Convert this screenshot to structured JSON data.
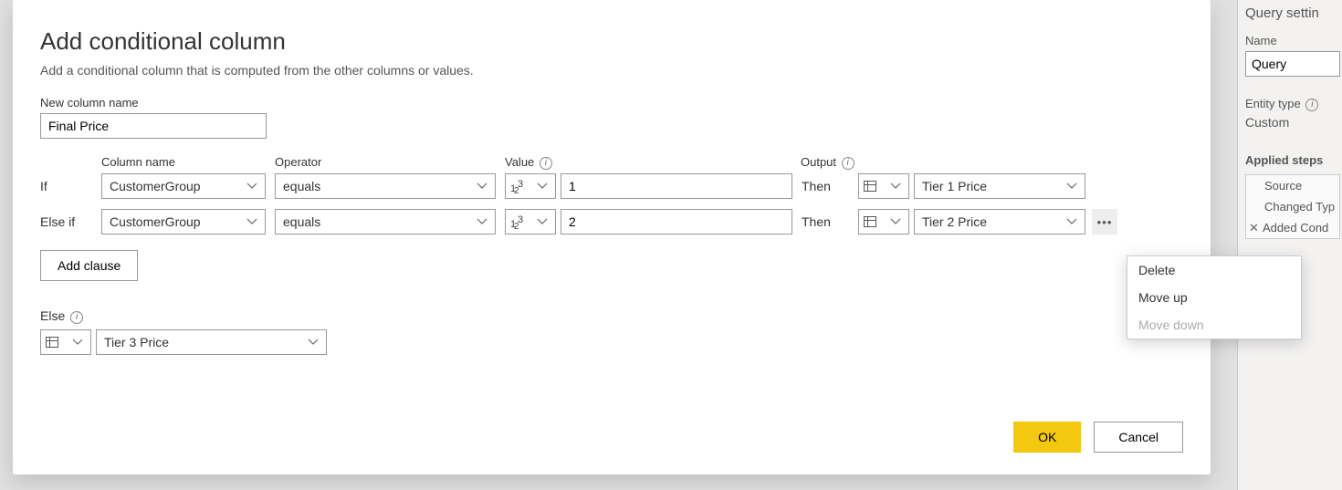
{
  "dialog": {
    "title": "Add conditional column",
    "description": "Add a conditional column that is computed from the other columns or values.",
    "new_col_label": "New column name",
    "new_col_value": "Final Price",
    "headers": {
      "column": "Column name",
      "operator": "Operator",
      "value": "Value",
      "output": "Output"
    },
    "clauses": [
      {
        "prefix": "If",
        "column": "CustomerGroup",
        "operator": "equals",
        "value_type": "number",
        "value": "1",
        "then": "Then",
        "output_type": "column",
        "output": "Tier 1 Price",
        "has_menu": false
      },
      {
        "prefix": "Else if",
        "column": "CustomerGroup",
        "operator": "equals",
        "value_type": "number",
        "value": "2",
        "then": "Then",
        "output_type": "column",
        "output": "Tier 2 Price",
        "has_menu": true
      }
    ],
    "add_clause_label": "Add clause",
    "else_label": "Else",
    "else_output_type": "column",
    "else_output": "Tier 3 Price",
    "ok_label": "OK",
    "cancel_label": "Cancel"
  },
  "context_menu": {
    "delete": "Delete",
    "move_up": "Move up",
    "move_down": "Move down"
  },
  "right_panel": {
    "title": "Query settin",
    "name_label": "Name",
    "name_value": "Query",
    "entity_label": "Entity type",
    "entity_value": "Custom",
    "steps_label": "Applied steps",
    "steps": [
      {
        "label": "Source",
        "x": false
      },
      {
        "label": "Changed Typ",
        "x": false
      },
      {
        "label": "Added Cond",
        "x": true
      }
    ]
  }
}
